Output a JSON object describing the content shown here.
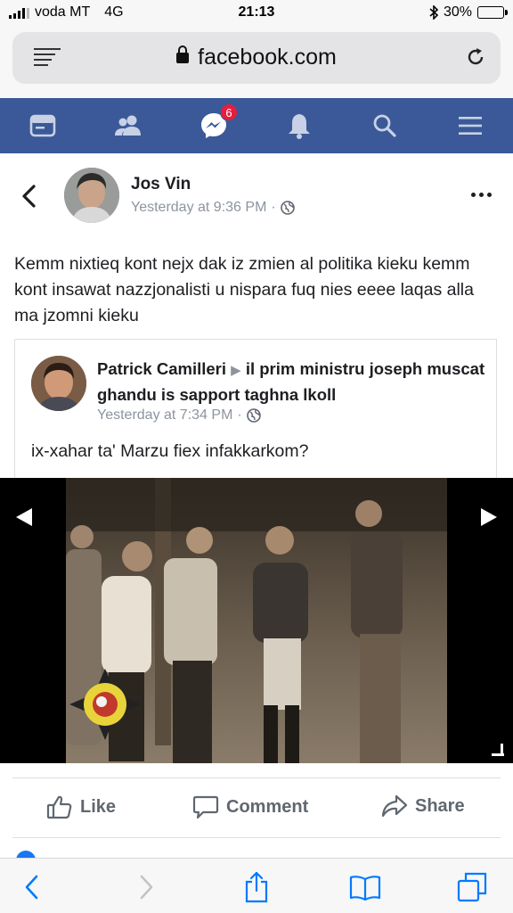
{
  "status_bar": {
    "carrier": "voda MT",
    "network": "4G",
    "time": "21:13",
    "battery_percent": "30%",
    "battery_level": 0.3
  },
  "browser": {
    "url": "facebook.com"
  },
  "nav": {
    "messenger_badge": "6",
    "icons": [
      "news-feed-icon",
      "friends-icon",
      "messenger-icon",
      "notifications-icon",
      "search-icon",
      "menu-icon"
    ],
    "accent_color": "#3b5998"
  },
  "post": {
    "author": "Jos Vin",
    "timestamp": "Yesterday at 9:36 PM",
    "separator": "·",
    "text": "Kemm nixtieq kont nejx dak iz zmien al politika kieku kemm kont insawat nazzjonalisti u nispara fuq nies eeee laqas alla ma jzomni kieku"
  },
  "shared": {
    "author": "Patrick Camilleri",
    "arrow": "▶",
    "target": "il prim ministru joseph muscat ghandu is sapport  taghna lkoll",
    "timestamp": "Yesterday at 7:34 PM",
    "separator": "·",
    "text": "ix-xahar ta' Marzu fiex infakkarkom?"
  },
  "actions": {
    "like": "Like",
    "comment": "Comment",
    "share": "Share"
  }
}
